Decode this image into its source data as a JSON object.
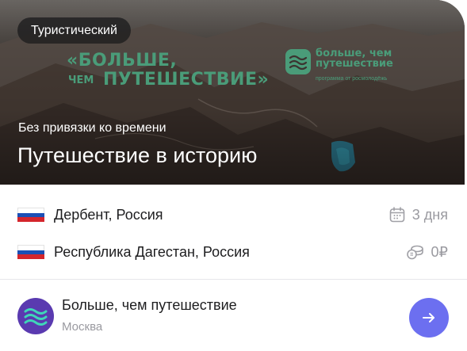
{
  "hero": {
    "badge": "Туристический",
    "slogan": {
      "line1": "«БОЛЬШЕ,",
      "line2_small": "ЧЕМ",
      "line2_big": "ПУТЕШЕСТВИЕ»"
    },
    "brand": {
      "name": "больше, чем путешествие",
      "sub": "программа от росмолодёжь"
    },
    "subtitle": "Без привязки ко времени",
    "title": "Путешествие в историю"
  },
  "details": {
    "locations": [
      {
        "flag": "russia-flag",
        "label": "Дербент, Россия"
      },
      {
        "flag": "russia-flag",
        "label": "Республика Дагестан, Россия"
      }
    ],
    "duration": {
      "icon": "calendar-icon",
      "value": "3 дня"
    },
    "price": {
      "icon": "coins-icon",
      "value": "0₽"
    }
  },
  "organizer": {
    "name": "Больше, чем путешествие",
    "city": "Москва",
    "action_icon": "arrow-right-icon"
  },
  "colors": {
    "accent": "#6c6ff0",
    "brand_green": "#4a9c79",
    "avatar": "#5a3ab0",
    "muted_text": "#9a9aa0"
  }
}
